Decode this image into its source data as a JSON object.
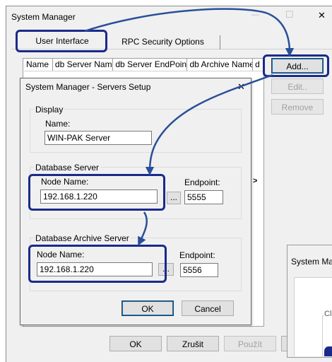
{
  "main_window": {
    "title": "System Manager",
    "tabs": [
      "User Interface",
      "RPC Security Options"
    ],
    "columns": [
      "Name",
      "db Server Name",
      "db Server EndPoint",
      "db Archive Name",
      "d"
    ],
    "add_label": "Add...",
    "edit_label": "Edit..",
    "remove_label": "Remove",
    "scroll_arrow": ">",
    "ok_label": "OK",
    "cancel_label": "Zrušit",
    "apply_label": "Použít",
    "close_glyph": "✕",
    "maximize_glyph": "☐",
    "minimize_glyph": "—"
  },
  "background_window": {
    "title": "System Ma",
    "fragment": "Cl"
  },
  "dialog": {
    "title": "System Manager - Servers Setup",
    "close_glyph": "✕",
    "display_group": "Display",
    "name_label": "Name:",
    "name_value": "WIN-PAK Server",
    "db_group": "Database Server",
    "node_label": "Node Name:",
    "node_value": "192.168.1.220",
    "endpoint_label": "Endpoint:",
    "endpoint_value": "5555",
    "browse_label": "...",
    "archive_group": "Database Archive Server",
    "archive_node_label": "Node Name:",
    "archive_node_value": "192.168.1.220",
    "archive_endpoint_label": "Endpoint:",
    "archive_endpoint_value": "5556",
    "archive_browse_label": "...",
    "ok_label": "OK",
    "cancel_label": "Cancel"
  },
  "colors": {
    "annotation": "#1a2a8a",
    "arrow": "#2a4f9a"
  }
}
